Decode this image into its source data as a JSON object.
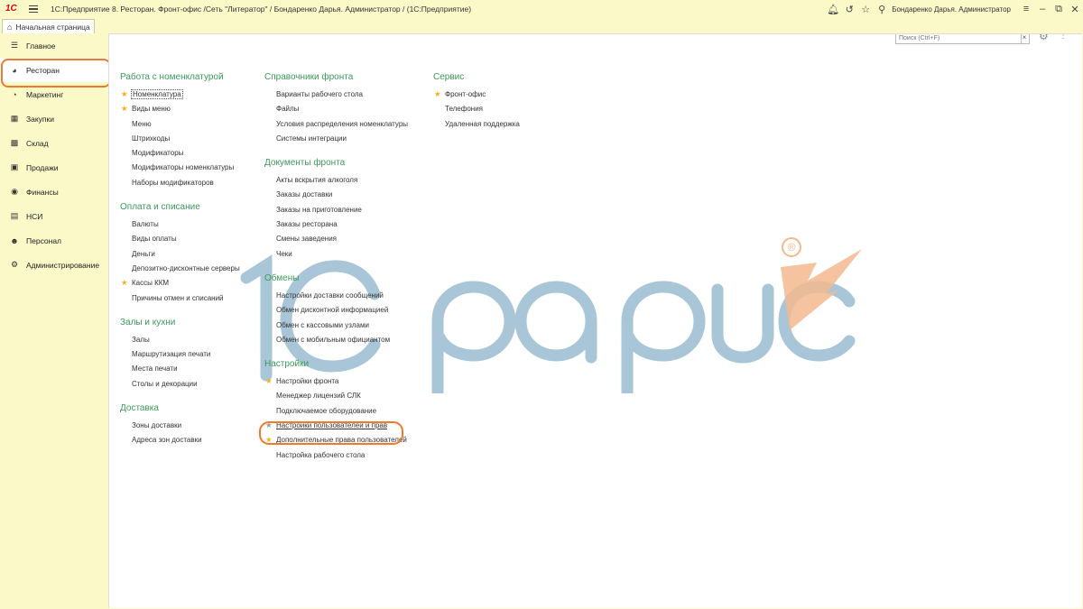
{
  "titlebar": {
    "logo": "1С",
    "title": "1С:Предприятие 8. Ресторан. Фронт-офис /Сеть \"Литератор\" / Бондаренко Дарья. Администратор /  (1С:Предприятие)",
    "user": "Бондаренко Дарья. Администратор"
  },
  "tabs": {
    "home": "Начальная страница"
  },
  "sidebar": {
    "items": [
      {
        "label": "Главное",
        "icon": "list-icon"
      },
      {
        "label": "Ресторан",
        "icon": "restaurant-icon"
      },
      {
        "label": "Маркетинг",
        "icon": "marketing-icon"
      },
      {
        "label": "Закупки",
        "icon": "purchases-icon"
      },
      {
        "label": "Склад",
        "icon": "warehouse-icon"
      },
      {
        "label": "Продажи",
        "icon": "sales-icon"
      },
      {
        "label": "Финансы",
        "icon": "finance-icon"
      },
      {
        "label": "НСИ",
        "icon": "reference-icon"
      },
      {
        "label": "Персонал",
        "icon": "personnel-icon"
      },
      {
        "label": "Администрирование",
        "icon": "gear-icon"
      }
    ]
  },
  "search": {
    "placeholder": "Поиск (Ctrl+F)",
    "clear": "×"
  },
  "columns": [
    {
      "groups": [
        {
          "title": "Работа с номенклатурой",
          "items": [
            {
              "label": "Номенклатура",
              "star": true,
              "boxed": true
            },
            {
              "label": "Виды меню",
              "star": true
            },
            {
              "label": "Меню"
            },
            {
              "label": "Штрихкоды"
            },
            {
              "label": "Модификаторы"
            },
            {
              "label": "Модификаторы номенклатуры"
            },
            {
              "label": "Наборы модификаторов"
            }
          ]
        },
        {
          "title": "Оплата и списание",
          "items": [
            {
              "label": "Валюты"
            },
            {
              "label": "Виды оплаты"
            },
            {
              "label": "Деньги"
            },
            {
              "label": "Депозитно-дисконтные серверы"
            },
            {
              "label": "Кассы ККМ",
              "star": true
            },
            {
              "label": "Причины отмен и списаний"
            }
          ]
        },
        {
          "title": "Залы и кухни",
          "items": [
            {
              "label": "Залы"
            },
            {
              "label": "Маршрутизация печати"
            },
            {
              "label": "Места печати"
            },
            {
              "label": "Столы и декорации"
            }
          ]
        },
        {
          "title": "Доставка",
          "items": [
            {
              "label": "Зоны доставки"
            },
            {
              "label": "Адреса зон доставки"
            }
          ]
        }
      ]
    },
    {
      "groups": [
        {
          "title": "Справочники фронта",
          "items": [
            {
              "label": "Варианты рабочего стола"
            },
            {
              "label": "Файлы"
            },
            {
              "label": "Условия распределения номенклатуры"
            },
            {
              "label": "Системы интеграции"
            }
          ]
        },
        {
          "title": "Документы фронта",
          "items": [
            {
              "label": "Акты вскрытия алкоголя"
            },
            {
              "label": "Заказы доставки"
            },
            {
              "label": "Заказы на приготовление"
            },
            {
              "label": "Заказы ресторана"
            },
            {
              "label": "Смены заведения"
            },
            {
              "label": "Чеки"
            }
          ]
        },
        {
          "title": "Обмены",
          "items": [
            {
              "label": "Настройки доставки сообщений"
            },
            {
              "label": "Обмен дисконтной информацией"
            },
            {
              "label": "Обмен с кассовыми узлами"
            },
            {
              "label": "Обмен с мобильным официантом"
            }
          ]
        },
        {
          "title": "Настройки",
          "items": [
            {
              "label": "Настройки фронта",
              "star": true
            },
            {
              "label": "Менеджер лицензий СЛК"
            },
            {
              "label": "Подключаемое оборудование"
            },
            {
              "label": "Настройки пользователей и прав",
              "star": true,
              "starGrey": true
            },
            {
              "label": "Дополнительные права пользователей",
              "star": true
            },
            {
              "label": "Настройка рабочего стола"
            }
          ]
        }
      ]
    },
    {
      "groups": [
        {
          "title": "Сервис",
          "items": [
            {
              "label": "Фронт-офис",
              "star": true
            },
            {
              "label": "Телефония"
            },
            {
              "label": "Удаленная поддержка"
            }
          ]
        }
      ]
    }
  ],
  "watermark": {
    "text": "1С рарус",
    "registered": "®"
  },
  "colors": {
    "background": "#fbf9c8",
    "group_title": "#3b9a5a",
    "star": "#f3b21a",
    "highlight": "#ef7a2b",
    "watermark": "#a9c6d8",
    "watermark_accent": "#f3b98f"
  }
}
